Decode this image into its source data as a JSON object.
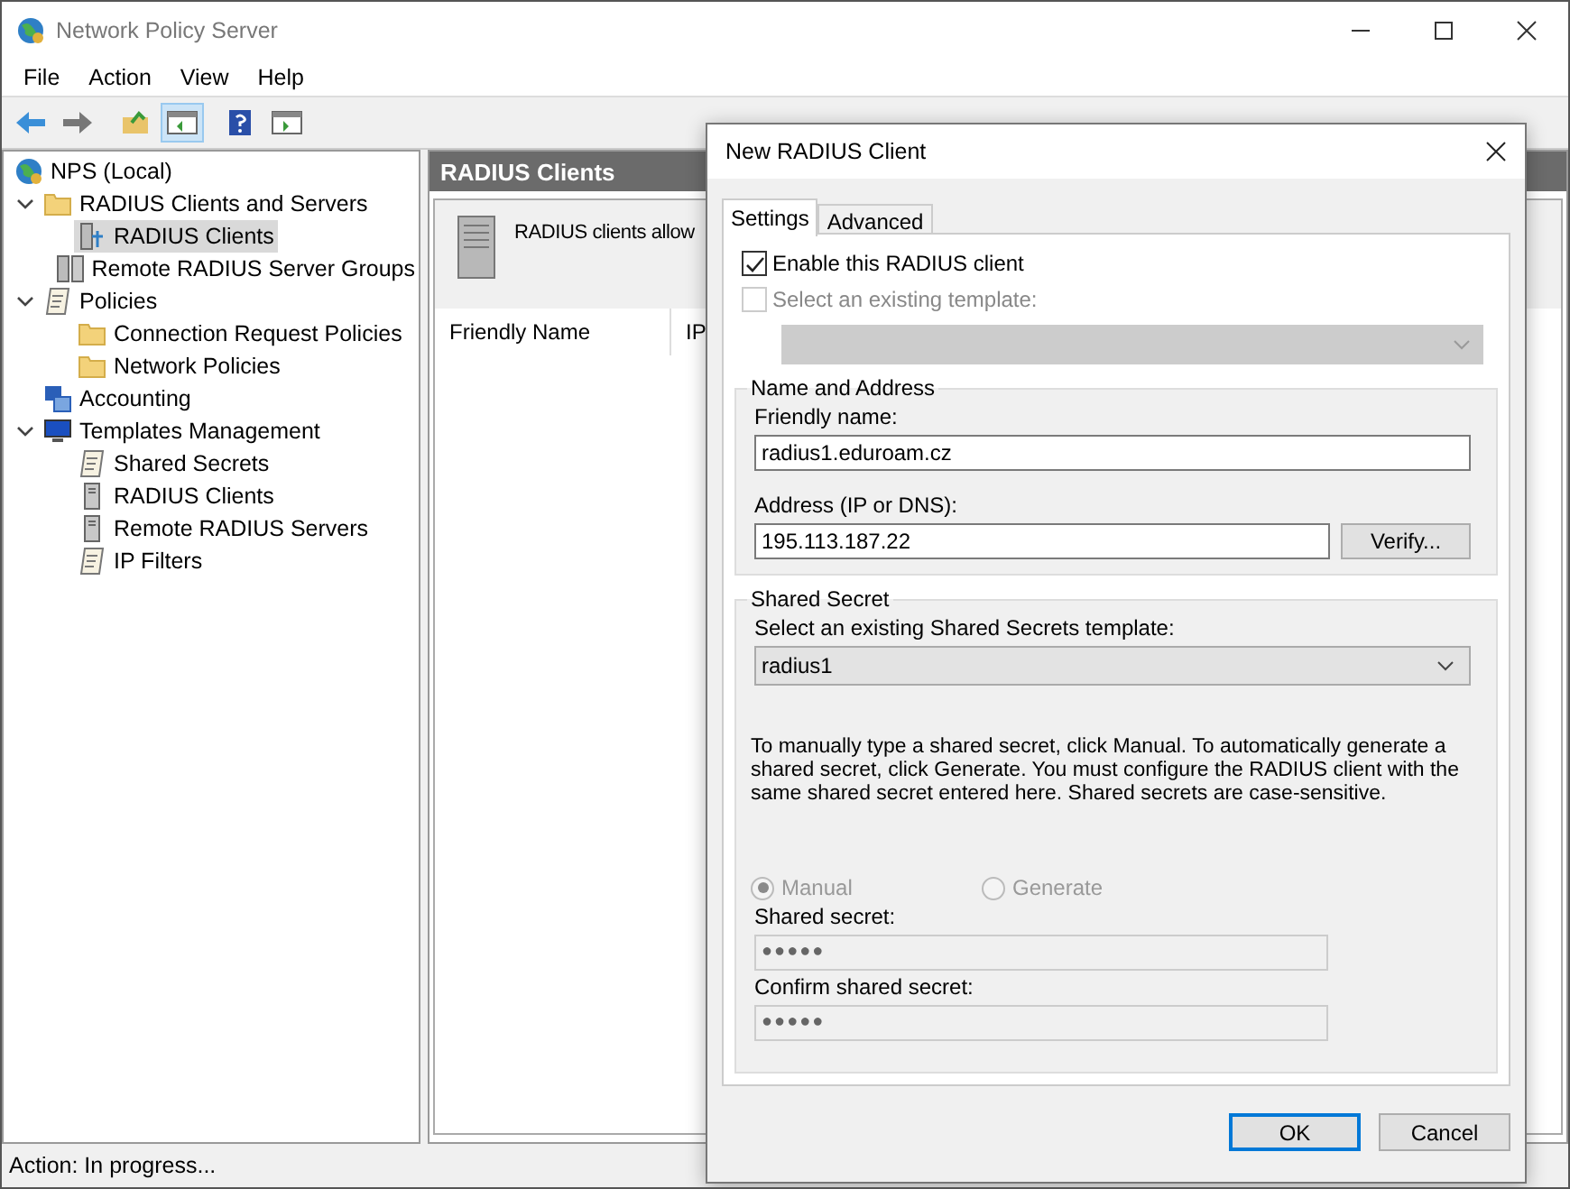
{
  "window": {
    "title": "Network Policy Server"
  },
  "menu": [
    "File",
    "Action",
    "View",
    "Help"
  ],
  "toolbar": [
    {
      "pressed": false
    },
    {
      "pressed": false
    },
    {
      "pressed": false
    },
    {
      "pressed": true
    },
    {
      "pressed": false
    },
    {
      "pressed": false
    }
  ],
  "tree": [
    {
      "label": "NPS (Local)",
      "kind": "root",
      "selected": false,
      "children": [
        {
          "label": "RADIUS Clients and Servers",
          "kind": "folder",
          "selected": false,
          "expanded": true,
          "children": [
            {
              "label": "RADIUS Clients",
              "kind": "clients",
              "selected": true
            },
            {
              "label": "Remote RADIUS Server Groups",
              "kind": "servers",
              "selected": false
            }
          ]
        },
        {
          "label": "Policies",
          "kind": "policy",
          "selected": false,
          "expanded": true,
          "children": [
            {
              "label": "Connection Request Policies",
              "kind": "folder",
              "selected": false
            },
            {
              "label": "Network Policies",
              "kind": "folder",
              "selected": false
            }
          ]
        },
        {
          "label": "Accounting",
          "kind": "accounting",
          "selected": false
        },
        {
          "label": "Templates Management",
          "kind": "templates",
          "selected": false,
          "expanded": true,
          "children": [
            {
              "label": "Shared Secrets",
              "kind": "policy",
              "selected": false
            },
            {
              "label": "RADIUS Clients",
              "kind": "server",
              "selected": false
            },
            {
              "label": "Remote RADIUS Servers",
              "kind": "server",
              "selected": false
            },
            {
              "label": "IP Filters",
              "kind": "policy",
              "selected": false
            }
          ]
        }
      ]
    }
  ],
  "content": {
    "header": "RADIUS Clients",
    "description": "RADIUS clients allow",
    "columns": [
      "Friendly Name",
      "IP"
    ]
  },
  "status_bar": "Action:  In progress...",
  "dialog": {
    "title": "New RADIUS Client",
    "tabs": [
      {
        "label": "Settings",
        "selected": true
      },
      {
        "label": "Advanced",
        "selected": false
      }
    ],
    "enable_client": {
      "label": "Enable this RADIUS client",
      "checked": true,
      "disabled": false
    },
    "use_template": {
      "label": "Select an existing template:",
      "checked": false,
      "disabled": true
    },
    "name_and_address": {
      "title": "Name and Address",
      "friendly_name_label": "Friendly name:",
      "friendly_name": "radius1.eduroam.cz",
      "address_label": "Address (IP or DNS):",
      "address": "195.113.187.22",
      "verify_button": "Verify..."
    },
    "shared_secret": {
      "title": "Shared Secret",
      "template_label": "Select an existing Shared Secrets template:",
      "template_value": "radius1",
      "help": "To manually type a shared secret, click Manual. To automatically generate a shared secret, click Generate. You must configure the RADIUS client with the same shared secret entered here. Shared secrets are case-sensitive.",
      "options": [
        {
          "label": "Manual",
          "selected": true,
          "disabled": true
        },
        {
          "label": "Generate",
          "selected": false,
          "disabled": true
        }
      ],
      "secret_label": "Shared secret:",
      "secret": "●●●●●",
      "confirm_label": "Confirm shared secret:",
      "confirm": "●●●●●"
    },
    "buttons": [
      {
        "label": "OK",
        "default": true
      },
      {
        "label": "Cancel",
        "default": false
      }
    ]
  }
}
